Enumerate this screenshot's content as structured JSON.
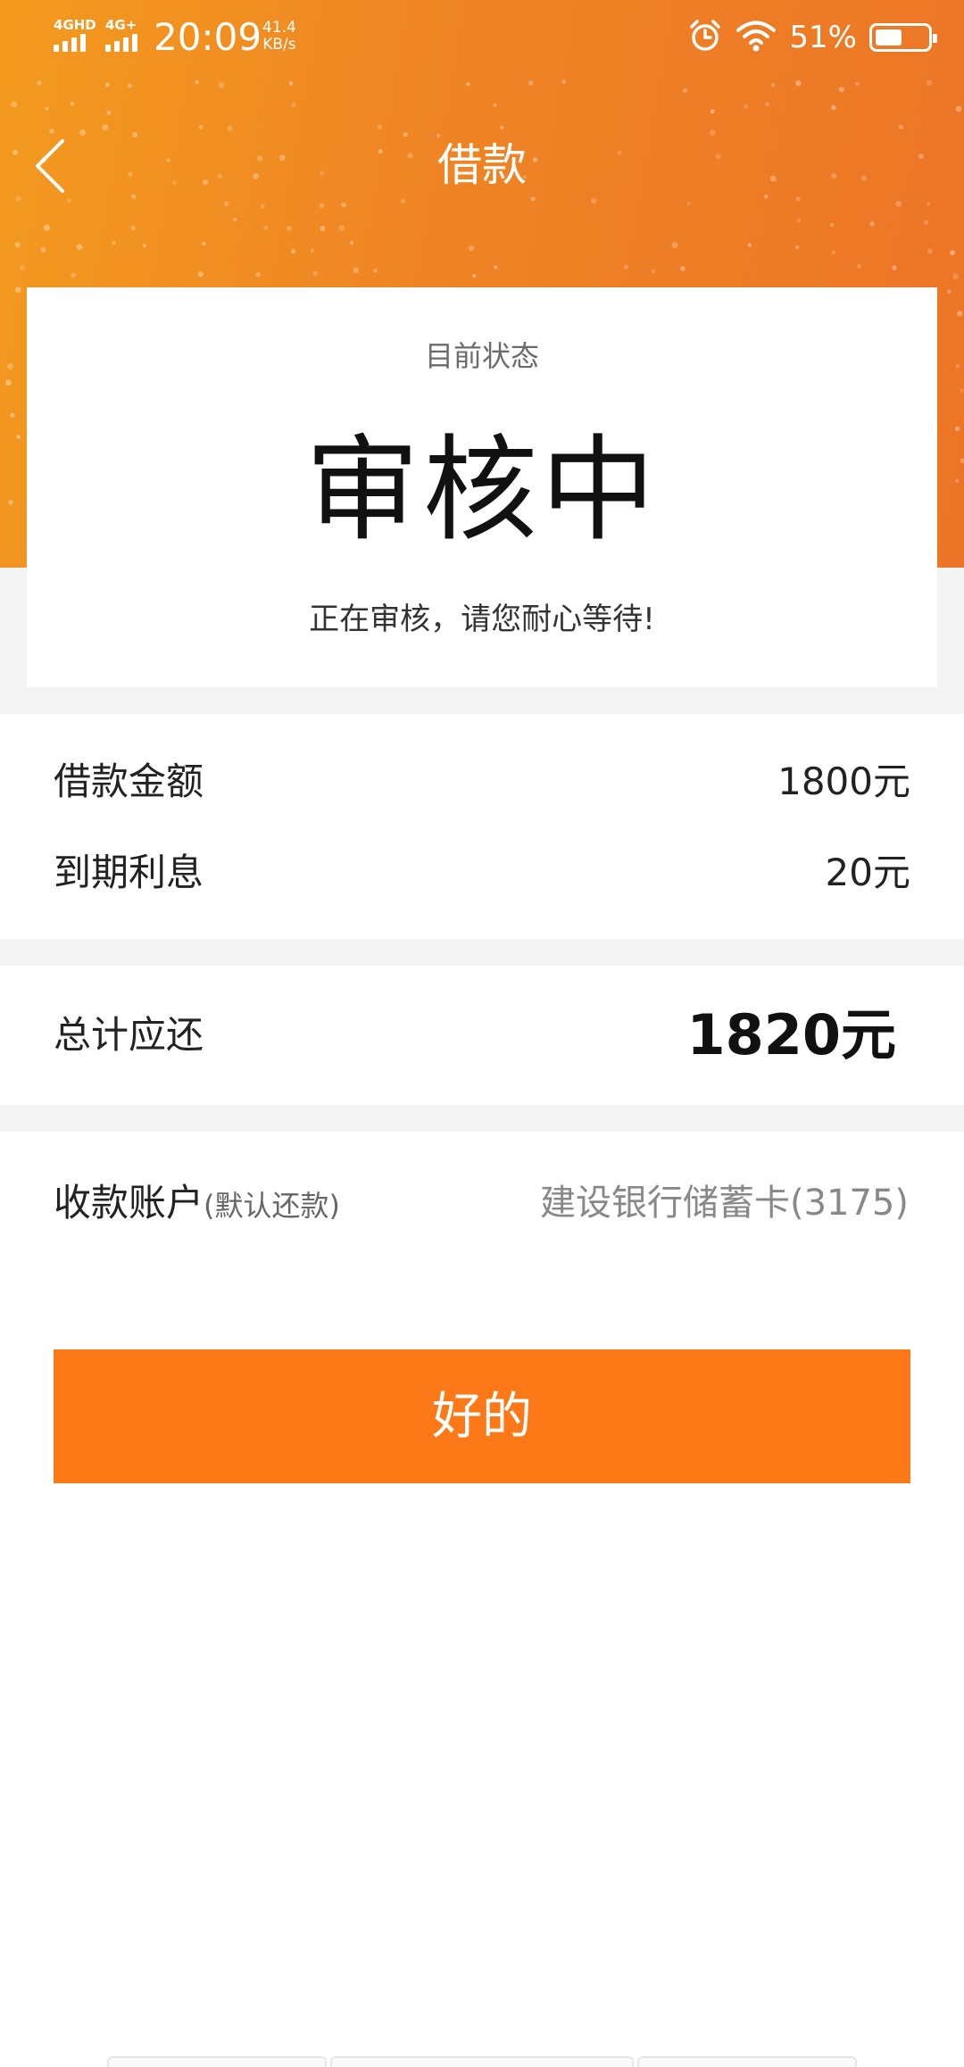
{
  "status_bar": {
    "network_1": "4GHD",
    "network_2": "4G+",
    "time": "20:09",
    "speed_value": "41.4",
    "speed_unit": "KB/s",
    "battery_text": "51%",
    "battery_level": 0.51
  },
  "nav": {
    "title": "借款"
  },
  "status_card": {
    "label": "目前状态",
    "value": "审核中",
    "note": "正在审核，请您耐心等待!"
  },
  "loan": {
    "amount_label": "借款金额",
    "amount_value": "1800元",
    "interest_label": "到期利息",
    "interest_value": "20元"
  },
  "total": {
    "label": "总计应还",
    "value": "1820元"
  },
  "account": {
    "label": "收款账户",
    "sub_label": "(默认还款)",
    "value": "建设银行储蓄卡(3175)"
  },
  "ok_button_label": "好的",
  "colors": {
    "accent": "#fd7817",
    "header_start": "#f39a1e",
    "header_end": "#ec7426"
  }
}
